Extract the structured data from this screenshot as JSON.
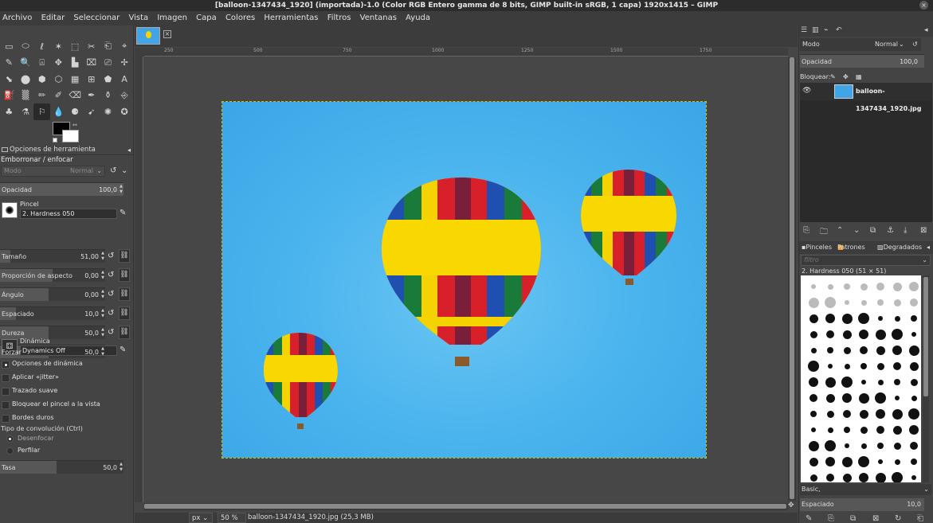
{
  "window": {
    "title": "[balloon-1347434_1920] (importada)-1.0 (Color RGB Entero gamma de 8 bits, GIMP built-in sRGB, 1 capa) 1920x1415 – GIMP",
    "close_glyph": "×"
  },
  "menubar": {
    "items": [
      "Archivo",
      "Editar",
      "Seleccionar",
      "Vista",
      "Imagen",
      "Capa",
      "Colores",
      "Herramientas",
      "Filtros",
      "Ventanas",
      "Ayuda"
    ]
  },
  "toolbox": {
    "tools": [
      "▭",
      "⬭",
      "ℓ",
      "✶",
      "⬚",
      "✂",
      "⎗",
      "⌖",
      "✎",
      "🔍",
      "⍓",
      "✥",
      "▙",
      "⌧",
      "⎚",
      "✢",
      "⬊",
      "⬤",
      "⬢",
      "⬡",
      "▦",
      "⊞",
      "⬟",
      "A",
      "⛽",
      "▒",
      "✏",
      "✐",
      "⌫",
      "✒",
      "⚱",
      "⎆",
      "♣",
      "⚗",
      "⚐",
      "💧",
      "⚈",
      "➹",
      "✺",
      "✪"
    ],
    "active_tool_index": 34
  },
  "tool_options": {
    "tab_label": "Opciones de herramienta",
    "tool_title": "Emborronar / enfocar",
    "mode_label": "Modo",
    "mode_value": "Normal",
    "opacity_label": "Opacidad",
    "opacity_value": "100,0",
    "brush_label": "Pincel",
    "brush_name": "2. Hardness 050",
    "sliders": [
      {
        "label": "Tamaño",
        "value": "51,00",
        "fill": 0.1
      },
      {
        "label": "Proporción de aspecto",
        "value": "0,00",
        "fill": 0.5
      },
      {
        "label": "Ángulo",
        "value": "0,00",
        "fill": 0.46
      },
      {
        "label": "Espaciado",
        "value": "10,0",
        "fill": 0.15
      },
      {
        "label": "Dureza",
        "value": "50,0",
        "fill": 0.46
      },
      {
        "label": "Forzar",
        "value": "50,0",
        "fill": 0.46
      }
    ],
    "dynamics_label": "Dinámica",
    "dynamics_name": "Dynamics Off",
    "checkboxes": [
      {
        "label": "Opciones de dinámica",
        "on": true
      },
      {
        "label": "Aplicar «jitter»",
        "on": false
      },
      {
        "label": "Trazado suave",
        "on": false
      },
      {
        "label": "Bloquear el pincel a la vista",
        "on": false
      },
      {
        "label": "Bordes duros",
        "on": false
      }
    ],
    "convolution_label": "Tipo de convolución  (Ctrl)",
    "radios": [
      {
        "label": "Desenfocar",
        "on": true
      },
      {
        "label": "Perfilar",
        "on": false
      }
    ],
    "rate_label": "Tasa",
    "rate_value": "50,0",
    "rate_fill": 0.46
  },
  "canvas": {
    "ruler_marks": [
      "250",
      "500",
      "750",
      "1000",
      "1250",
      "1500",
      "1750"
    ],
    "ruler_left_marks": [
      "2",
      "5",
      "0",
      "7",
      "5",
      "0",
      "1",
      "0",
      "0",
      "0",
      "1",
      "2",
      "5",
      "0"
    ],
    "unit": "px",
    "zoom": "50 %",
    "status": "balloon-1347434_1920.jpg (25,3 MB)"
  },
  "dock": {
    "mode_label": "Modo",
    "mode_value": "Normal",
    "opacity_label": "Opacidad",
    "opacity_value": "100,0",
    "lock_label": "Bloquear:",
    "layer_name": "balloon-1347434_1920.jpg",
    "brush_tabs": [
      "Pinceles",
      "Patrones",
      "Degradados"
    ],
    "filter_placeholder": "filtro",
    "current_brush": "2. Hardness 050 (51 × 51)",
    "brush_set": "Basic,",
    "spacing_label": "Espaciado",
    "spacing_value": "10,0"
  },
  "colors": {
    "sky": "#4ab4ee",
    "yellow": "#f5d300",
    "red": "#d8202a",
    "green": "#1a7a3a",
    "blue": "#1f4fb0",
    "purple": "#6a2a7a"
  }
}
